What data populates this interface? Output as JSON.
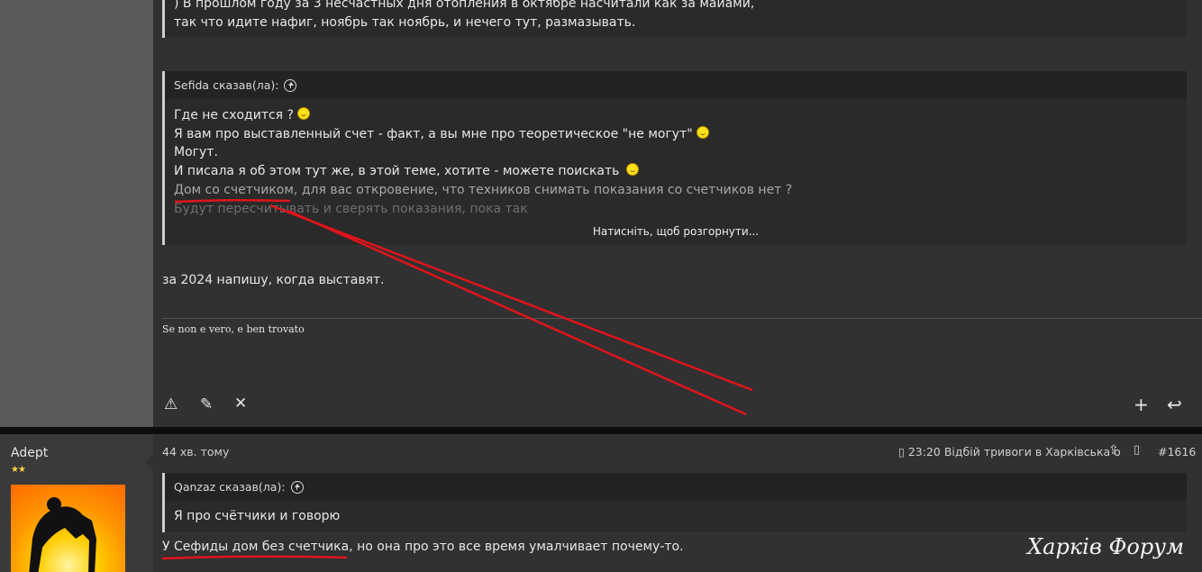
{
  "post1": {
    "top_quote": {
      "line1": ") В прошлом году за 3 несчастных дня отопления в октябре насчитали как за маиами,",
      "line2": "так что идите нафиг, ноябрь так ноябрь, и нечего тут, размазывать."
    },
    "quote": {
      "author": "Sefida сказав(ла):",
      "lines": [
        "Где не сходится ?",
        "Я вам про выставленный счет - факт, а вы мне про теоретическое \"не могут\"",
        "Могут.",
        "И писала я об этом тут же, в этой теме, хотите - можете поискать",
        "Дом со счетчиком, для вас откровение, что техников снимать показания со счетчиков нет ?",
        "Будут пересчитывать и сверять показания, пока так"
      ],
      "expand_label": "Натисніть, щоб розгорнути..."
    },
    "body": "за 2024 напишу, когда выставят.",
    "signature": "Se non e vero, e ben trovato",
    "icons": [
      "warning-icon",
      "edit-icon",
      "delete-icon",
      "add-icon",
      "reply-icon"
    ]
  },
  "post2": {
    "username": "Adept",
    "rank_stars": "★★",
    "time": "44 хв. тому",
    "notice": "▯ 23:20 Відбій тривоги в Харківська о",
    "post_number": "#1616",
    "quote": {
      "author": "Qanzaz сказав(ла):",
      "text": "Я про счётчики и говорю"
    },
    "body": "У Сефиды дом без счетчика, но она про это все время умалчивает почему-то."
  },
  "watermark": "Харків Форум",
  "colors": {
    "annotation": "#e0141b",
    "smiley": "#ffe21a"
  }
}
